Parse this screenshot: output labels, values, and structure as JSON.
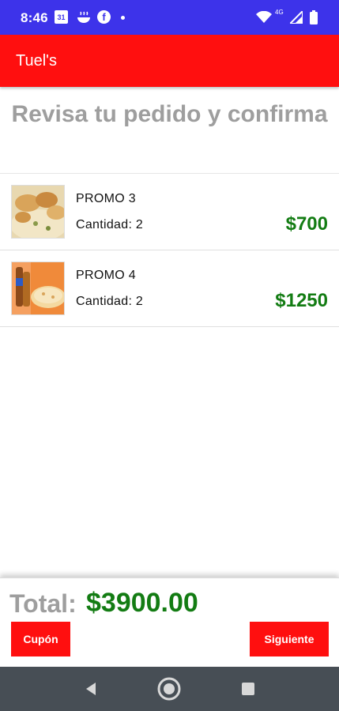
{
  "status_bar": {
    "time": "8:46",
    "calendar_day": "31",
    "network": "4G",
    "icons": [
      "calendar-icon",
      "bowl-icon",
      "facebook-icon",
      "notification-dot-icon",
      "wifi-icon",
      "signal-icon",
      "battery-icon"
    ]
  },
  "app_bar": {
    "title": "Tuel's"
  },
  "heading": "Revisa tu pedido y confirma",
  "order_items": [
    {
      "name": "PROMO 3",
      "quantity": "Cantidad: 2",
      "price": "$700"
    },
    {
      "name": "PROMO 4",
      "quantity": "Cantidad: 2",
      "price": "$1250"
    }
  ],
  "footer": {
    "total_label": "Total:",
    "total_value": "$3900.00",
    "coupon_button": "Cupón",
    "next_button": "Siguiente"
  },
  "nav_bar": {
    "icons": [
      "back-icon",
      "home-icon",
      "recents-icon"
    ]
  },
  "colors": {
    "status_bar": "#3d33ea",
    "app_bar": "#ff0f0f",
    "price_green": "#137c13",
    "heading_gray": "#9e9e9e",
    "nav_bar": "#474e55"
  }
}
